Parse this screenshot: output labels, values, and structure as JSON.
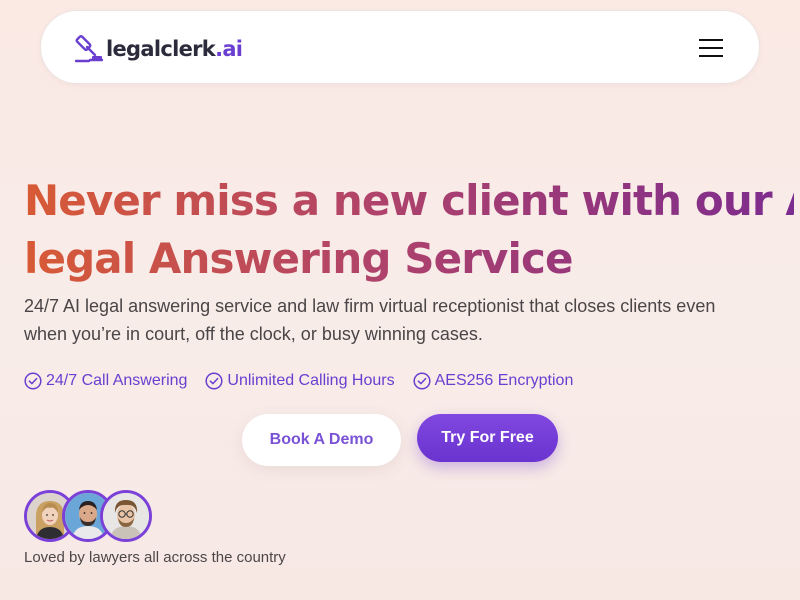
{
  "nav": {
    "logo_text": "legalclerk",
    "logo_suffix": ".ai",
    "menu_icon": "hamburger-menu-icon"
  },
  "hero": {
    "headline_line1": "Never miss a new client with our AI",
    "headline_line2": "legal Answering Service",
    "subtitle_line1": "24/7 AI legal answering service and law firm virtual receptionist that closes clients even",
    "subtitle_line2": "when you’re in court, off the clock, or busy winning cases.",
    "features": [
      {
        "label": "24/7 Call Answering",
        "icon": "check-circle-icon"
      },
      {
        "label": "Unlimited Calling Hours",
        "icon": "check-circle-icon"
      },
      {
        "label": "AES256 Encryption",
        "icon": "check-circle-icon"
      }
    ],
    "buttons": {
      "demo_label": "Book A Demo",
      "try_label": "Try For Free"
    }
  },
  "social_proof": {
    "caption": "Loved by lawyers all across the country"
  },
  "colors": {
    "brand_purple": "#6a3fd0",
    "headline_gradient_start": "#d85a35",
    "headline_gradient_end": "#7c2b8e",
    "background": "#f9ebe7"
  }
}
